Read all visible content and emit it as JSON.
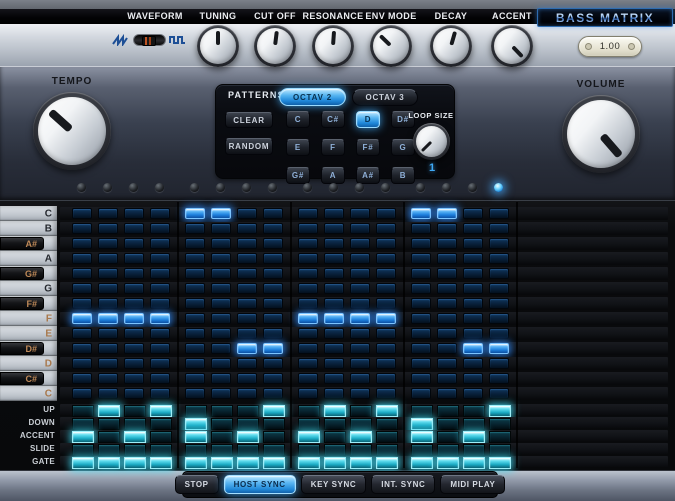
{
  "header": {
    "labels": [
      "WAVEFORM",
      "TUNING",
      "CUT OFF",
      "RESONANCE",
      "ENV MODE",
      "DECAY",
      "ACCENT"
    ],
    "logo": "BASS MATRIX",
    "value_display": "1.00",
    "waveform_switch": {
      "icons": [
        "sawtooth-wave",
        "square-wave"
      ],
      "position": "left"
    },
    "knobs": [
      {
        "id": "tuning",
        "angle": 0
      },
      {
        "id": "cutoff",
        "angle": 7
      },
      {
        "id": "resonance",
        "angle": 4
      },
      {
        "id": "envmode",
        "angle": -46
      },
      {
        "id": "decay",
        "angle": 16
      },
      {
        "id": "accent",
        "angle": 136
      }
    ]
  },
  "controls": {
    "tempo": {
      "label": "TEMPO",
      "angle": -48
    },
    "volume": {
      "label": "VOLUME",
      "angle": 139
    }
  },
  "patterns": {
    "title": "PATTERNS",
    "octave_buttons": [
      {
        "label": "OCTAV 2",
        "active": true
      },
      {
        "label": "OCTAV 3",
        "active": false
      }
    ],
    "clear_label": "CLEAR",
    "random_label": "RANDOM",
    "note_buttons": [
      {
        "label": "C",
        "active": false
      },
      {
        "label": "C#",
        "active": false
      },
      {
        "label": "D",
        "active": true
      },
      {
        "label": "D#",
        "active": false
      },
      {
        "label": "E",
        "active": false
      },
      {
        "label": "F",
        "active": false
      },
      {
        "label": "F#",
        "active": false
      },
      {
        "label": "G",
        "active": false
      },
      {
        "label": "G#",
        "active": false
      },
      {
        "label": "A",
        "active": false
      },
      {
        "label": "A#",
        "active": false
      },
      {
        "label": "B",
        "active": false
      }
    ],
    "loop_size": {
      "label": "LOOP SIZE",
      "value": "1",
      "angle": -135
    }
  },
  "step_leds": {
    "count": 16,
    "lit": [
      16
    ]
  },
  "sequencer": {
    "columns": 16,
    "note_rows": [
      {
        "note": "C",
        "key": "white",
        "tint": "dark",
        "steps": [
          5,
          6,
          13,
          14
        ]
      },
      {
        "note": "B",
        "key": "white",
        "tint": "dark",
        "steps": []
      },
      {
        "note": "A#",
        "key": "black",
        "tint": "tan",
        "steps": []
      },
      {
        "note": "A",
        "key": "white",
        "tint": "dark",
        "steps": []
      },
      {
        "note": "G#",
        "key": "black",
        "tint": "tan",
        "steps": []
      },
      {
        "note": "G",
        "key": "white",
        "tint": "dark",
        "steps": []
      },
      {
        "note": "F#",
        "key": "black",
        "tint": "tan",
        "steps": []
      },
      {
        "note": "F",
        "key": "white",
        "tint": "tan",
        "steps": [
          1,
          2,
          3,
          4,
          9,
          10,
          11,
          12
        ]
      },
      {
        "note": "E",
        "key": "white",
        "tint": "tan",
        "steps": []
      },
      {
        "note": "D#",
        "key": "black",
        "tint": "tan",
        "steps": [
          7,
          8,
          15,
          16
        ]
      },
      {
        "note": "D",
        "key": "white",
        "tint": "tan",
        "steps": []
      },
      {
        "note": "C#",
        "key": "black",
        "tint": "tan",
        "steps": []
      },
      {
        "note": "C",
        "key": "white",
        "tint": "tan",
        "steps": []
      }
    ],
    "control_rows": [
      {
        "label": "UP",
        "steps": [
          2,
          4,
          8,
          10,
          12,
          16
        ]
      },
      {
        "label": "DOWN",
        "steps": [
          5,
          13
        ]
      },
      {
        "label": "ACCENT",
        "steps": [
          1,
          3,
          5,
          7,
          9,
          11,
          13,
          15
        ]
      },
      {
        "label": "SLIDE",
        "steps": []
      },
      {
        "label": "GATE",
        "steps": [
          1,
          2,
          3,
          4,
          5,
          6,
          7,
          8,
          9,
          10,
          11,
          12,
          13,
          14,
          15,
          16
        ]
      }
    ]
  },
  "transport": {
    "buttons": [
      {
        "label": "STOP",
        "active": false
      },
      {
        "label": "HOST SYNC",
        "active": true
      },
      {
        "label": "KEY SYNC",
        "active": false
      },
      {
        "label": "INT. SYNC",
        "active": false
      },
      {
        "label": "MIDI PLAY",
        "active": false
      }
    ]
  },
  "colors": {
    "accent_blue": "#3fa9f5",
    "accent_cyan": "#4fd8e8",
    "led_blue": "#4fc3f7",
    "logo_blue": "#6aa8e8",
    "black_key_text": "#c08a58"
  }
}
